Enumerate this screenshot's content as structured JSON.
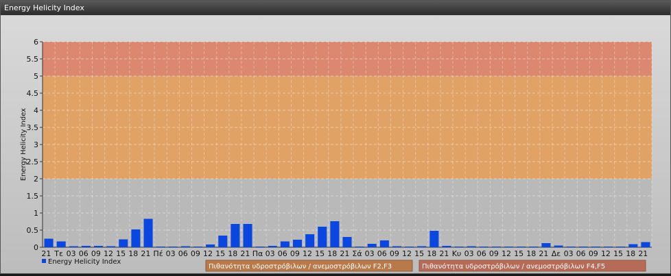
{
  "window": {
    "title": "Energy Helicity Index"
  },
  "chart_data": {
    "type": "bar",
    "title": "Energy Helicity Index",
    "ylabel": "Energy Helicity Index",
    "xlabel": "",
    "ylim": [
      0,
      6
    ],
    "yticks": [
      "0",
      "0.5",
      "1",
      "1.5",
      "2",
      "2.5",
      "3",
      "3.5",
      "4",
      "4.5",
      "5",
      "5.5",
      "6"
    ],
    "grid": true,
    "legend": "bottom-left",
    "categories": [
      "21",
      "Τε",
      "03",
      "06",
      "09",
      "12",
      "15",
      "18",
      "21",
      "Πέ",
      "03",
      "06",
      "09",
      "12",
      "15",
      "18",
      "21",
      "Πα",
      "03",
      "06",
      "09",
      "12",
      "15",
      "18",
      "21",
      "Σά",
      "03",
      "06",
      "09",
      "12",
      "15",
      "18",
      "21",
      "Κυ",
      "03",
      "06",
      "09",
      "12",
      "15",
      "18",
      "21",
      "Δε",
      "03",
      "06",
      "09",
      "12",
      "15",
      "18",
      "21"
    ],
    "series": [
      {
        "name": "Energy Helicity Index",
        "color": "#0a47e0",
        "values": [
          0.25,
          0.17,
          0.03,
          0.04,
          0.04,
          0.03,
          0.23,
          0.52,
          0.83,
          0.02,
          0.02,
          0.03,
          0.02,
          0.08,
          0.34,
          0.68,
          0.68,
          0.02,
          0.04,
          0.17,
          0.22,
          0.38,
          0.6,
          0.76,
          0.3,
          0.02,
          0.1,
          0.2,
          0.03,
          0.02,
          0.03,
          0.48,
          0.04,
          0.02,
          0.03,
          0.02,
          0.02,
          0.02,
          0.02,
          0.02,
          0.12,
          0.05,
          0.02,
          0.02,
          0.02,
          0.02,
          0.02,
          0.09,
          0.15
        ]
      }
    ],
    "bands": [
      {
        "from": 2,
        "to": 5,
        "color": "#e4a05c",
        "label": "Πιθανότητα υδροστρόβιλων / ανεμοστρόβιλων F2,F3",
        "label_color": "#b87a4a"
      },
      {
        "from": 5,
        "to": 6,
        "color": "#e08268",
        "label": "Πιθανότητα υδροστρόβιλων / ανεμοστρόβιλων F4,F5",
        "label_color": "#b86a58"
      }
    ]
  }
}
